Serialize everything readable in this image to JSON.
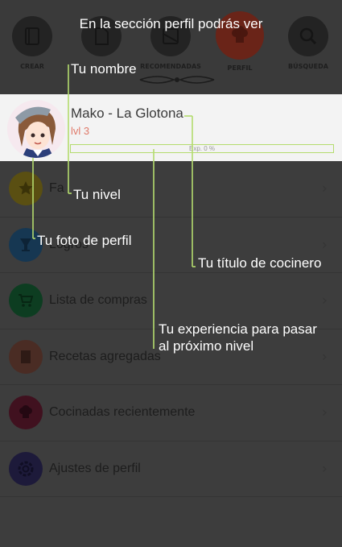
{
  "nav": [
    {
      "label": "CREAR",
      "icon": "book-icon"
    },
    {
      "label": "",
      "icon": "recipe-card-icon"
    },
    {
      "label": "RECOMENDADAS",
      "icon": "recommended-icon"
    },
    {
      "label": "PERFIL",
      "icon": "chef-hat-icon",
      "active": true
    },
    {
      "label": "BÚSQUEDA",
      "icon": "search-icon"
    }
  ],
  "profile": {
    "name": "Mako - La Glotona",
    "level": "lvl 3",
    "xp_text": "Exp. 0 %",
    "xp_progress": 0
  },
  "menu": [
    {
      "label": "Fa",
      "icon": "star-icon",
      "color": "#5a4f12"
    },
    {
      "label": "Logros",
      "icon": "trophy-icon",
      "color": "#163752"
    },
    {
      "label": "Lista de compras",
      "icon": "cart-icon",
      "color": "#0d3d21"
    },
    {
      "label": "Recetas agregadas",
      "icon": "recipe-book-icon",
      "color": "#4a2c24"
    },
    {
      "label": "Cocinadas recientemente",
      "icon": "chef-hat-icon",
      "color": "#40111f"
    },
    {
      "label": "Ajustes de perfil",
      "icon": "gear-icon",
      "color": "#1d1a3a"
    }
  ],
  "overlay": {
    "hint": "En la sección perfil podrás ver",
    "name_callout": "Tu nombre",
    "level_callout": "Tu nivel",
    "photo_callout": "Tu foto de perfil",
    "title_callout": "Tu título de cocinero",
    "xp_callout_1": "Tu experiencia para pasar",
    "xp_callout_2": "al próximo nivel",
    "line_color": "#b4dc6e"
  }
}
